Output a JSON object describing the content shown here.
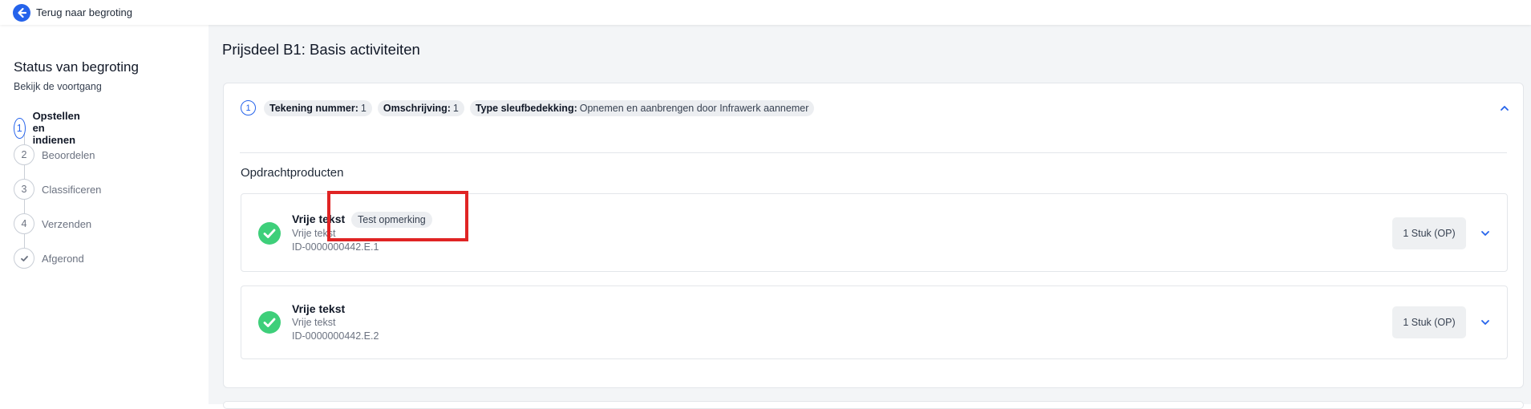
{
  "topbar": {
    "back_label": "Terug naar begroting"
  },
  "sidebar": {
    "title": "Status van begroting",
    "subtitle": "Bekijk de voortgang",
    "steps": [
      {
        "number": "1",
        "label": "Opstellen en indienen",
        "state": "active"
      },
      {
        "number": "2",
        "label": "Beoordelen",
        "state": "pending"
      },
      {
        "number": "3",
        "label": "Classificeren",
        "state": "pending"
      },
      {
        "number": "4",
        "label": "Verzenden",
        "state": "pending"
      },
      {
        "number": "",
        "label": "Afgerond",
        "state": "done-icon"
      }
    ]
  },
  "main": {
    "page_title": "Prijsdeel B1: Basis activiteiten",
    "card": {
      "number": "1",
      "tags": [
        {
          "key": "Tekening nummer:",
          "value": "1"
        },
        {
          "key": "Omschrijving:",
          "value": "1"
        },
        {
          "key": "Type sleufbedekking:",
          "value": "Opnemen en aanbrengen door Infrawerk aannemer"
        }
      ],
      "section_title": "Opdrachtproducten",
      "products": [
        {
          "title": "Vrije tekst",
          "remark": "Test opmerking",
          "subtitle": "Vrije tekst",
          "id": "ID-0000000442.E.1",
          "quantity": "1 Stuk (OP)",
          "status": "complete"
        },
        {
          "title": "Vrije tekst",
          "remark": "",
          "subtitle": "Vrije tekst",
          "id": "ID-0000000442.E.2",
          "quantity": "1 Stuk (OP)",
          "status": "complete"
        }
      ]
    }
  },
  "colors": {
    "accent": "#2563eb",
    "success": "#3ecf7a",
    "highlight": "#e02424",
    "page_bg": "#f3f5f7"
  },
  "icons": {
    "back": "arrow-left-circle-icon",
    "done": "check-icon",
    "collapse": "chevron-up-icon",
    "expand": "chevron-down-icon",
    "status": "check-circle-icon"
  }
}
